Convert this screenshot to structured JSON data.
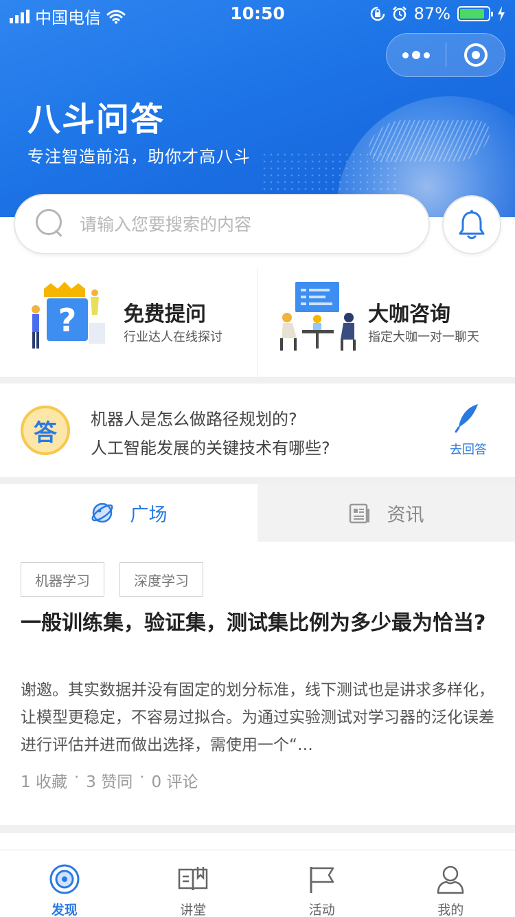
{
  "status_bar": {
    "carrier": "中国电信",
    "time": "10:50",
    "battery": "87%",
    "battery_level": 0.87
  },
  "header": {
    "title": "八斗问答",
    "subtitle": "专注智造前沿，助你才高八斗"
  },
  "search": {
    "placeholder": "请输入您要搜索的内容"
  },
  "features": [
    {
      "name": "免费提问",
      "desc": "行业达人在线探讨",
      "icon": "question-illustration"
    },
    {
      "name": "大咖咨询",
      "desc": "指定大咖一对一聊天",
      "icon": "consult-illustration"
    }
  ],
  "hot": {
    "badge": "答",
    "questions": [
      "机器人是怎么做路径规划的?",
      "人工智能发展的关键技术有哪些?"
    ],
    "answer_label": "去回答"
  },
  "tabs": [
    {
      "label": "广场",
      "icon": "planet-icon",
      "active": true
    },
    {
      "label": "资讯",
      "icon": "news-icon",
      "active": false
    }
  ],
  "article": {
    "tags": [
      "机器学习",
      "深度学习"
    ],
    "title": "一般训练集，验证集，测试集比例为多少最为恰当?",
    "body": "谢邀。其实数据并没有固定的划分标准，线下测试也是讲求多样化，让模型更稳定，不容易过拟合。为通过实验测试对学习器的泛化误差进行评估并进而做出选择，需使用一个“…",
    "favorites": "1 收藏",
    "likes": "3 赞同",
    "comments": "0 评论",
    "separator": "·"
  },
  "tabbar": [
    {
      "label": "发现",
      "icon": "discover-icon",
      "active": true
    },
    {
      "label": "讲堂",
      "icon": "lecture-icon",
      "active": false
    },
    {
      "label": "活动",
      "icon": "flag-icon",
      "active": false
    },
    {
      "label": "我的",
      "icon": "user-icon",
      "active": false
    }
  ],
  "colors": {
    "primary": "#2a7ae2",
    "header_start": "#2f86f0",
    "header_end": "#1560d8",
    "battery": "#4cd964"
  }
}
